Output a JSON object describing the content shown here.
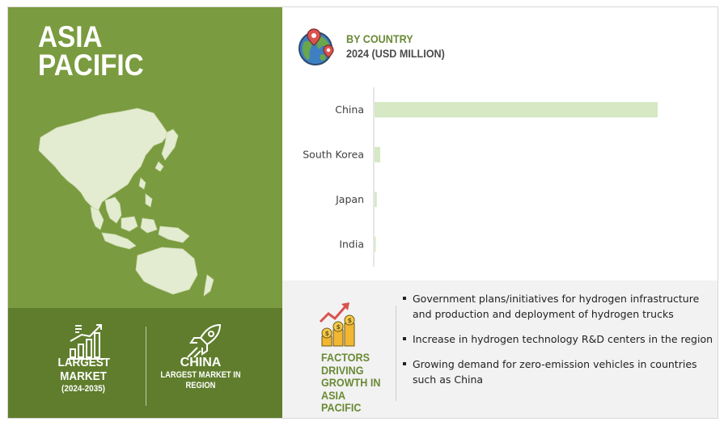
{
  "region": {
    "title": "ASIA\nPACIFIC"
  },
  "stats": {
    "largest": {
      "line1": "LARGEST",
      "line2": "MARKET",
      "period": "(2024-2035)"
    },
    "country": {
      "name": "CHINA",
      "desc_line1": "LARGEST MARKET IN",
      "desc_line2": "REGION"
    }
  },
  "chart_header": {
    "line1": "BY COUNTRY",
    "line2": "2024 (USD MILLION)"
  },
  "chart_data": {
    "type": "bar",
    "orientation": "horizontal",
    "title": "BY COUNTRY",
    "subtitle": "2024 (USD MILLION)",
    "categories": [
      "China",
      "South Korea",
      "Japan",
      "India"
    ],
    "values": [
      100,
      2,
      0.8,
      0.4
    ],
    "bar_color": "#d6e8c4",
    "grid": false
  },
  "factors": {
    "title": "FACTORS DRIVING GROWTH IN ASIA PACIFIC",
    "items": [
      "Government plans/initiatives for hydrogen infrastructure and production and deployment of hydrogen trucks",
      "Increase in hydrogen technology R&D centers in the region",
      "Growing demand for zero-emission vehicles in countries such as China"
    ]
  },
  "colors": {
    "panel": "#7a9b3f",
    "panel_dark": "#5f7d2c",
    "accent": "#6a8a35",
    "bar": "#d6e8c4"
  },
  "icons": [
    "globe-pin-icon",
    "bar-growth-icon",
    "rocket-icon",
    "coins-growth-icon"
  ]
}
